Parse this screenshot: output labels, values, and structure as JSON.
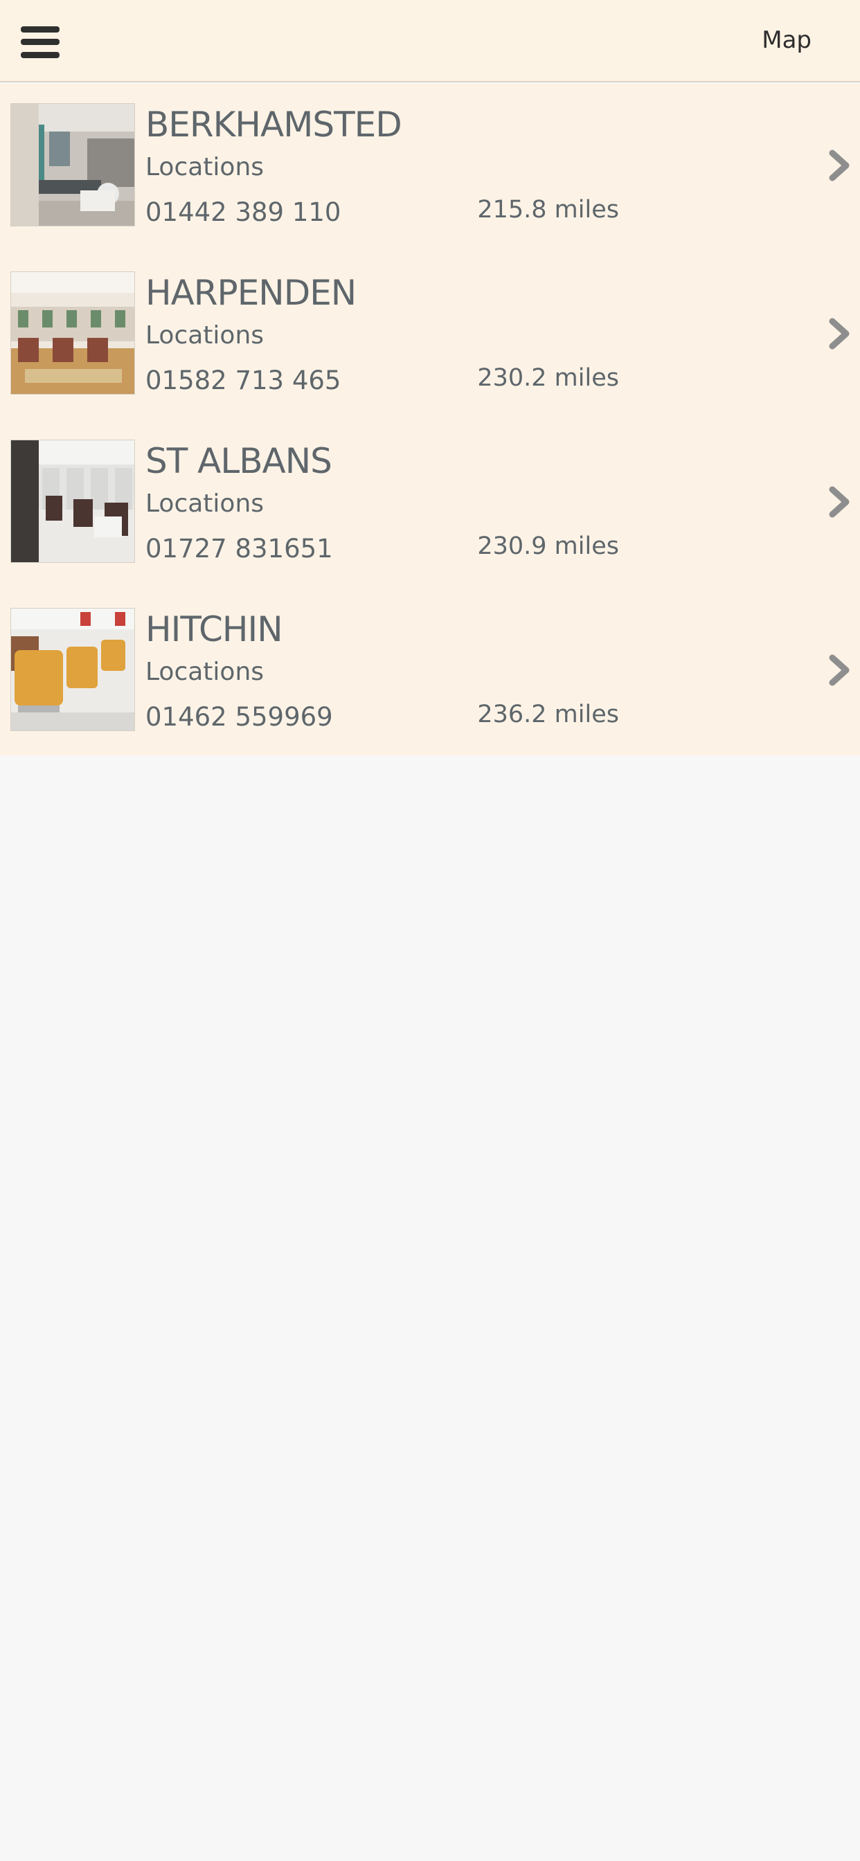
{
  "header": {
    "menu_icon": "hamburger-menu-icon",
    "map_label": "Map"
  },
  "locations": [
    {
      "name": "BERKHAMSTED",
      "category": "Locations",
      "phone": "01442 389 110",
      "distance": "215.8 miles",
      "image": "barbershop-interior-grey"
    },
    {
      "name": "HARPENDEN",
      "category": "Locations",
      "phone": "01582 713 465",
      "distance": "230.2 miles",
      "image": "barbershop-interior-wood"
    },
    {
      "name": "ST ALBANS",
      "category": "Locations",
      "phone": "01727 831651",
      "distance": "230.9 miles",
      "image": "barbershop-interior-dark-chairs"
    },
    {
      "name": "HITCHIN",
      "category": "Locations",
      "phone": "01462 559969",
      "distance": "236.2 miles",
      "image": "barbershop-interior-orange-chairs"
    }
  ],
  "colors": {
    "header_bg": "#fdf3e4",
    "list_bg": "#fcf3e6",
    "text": "#5e666b",
    "chevron": "#8e8e8e",
    "page_bg": "#f7f7f7"
  }
}
